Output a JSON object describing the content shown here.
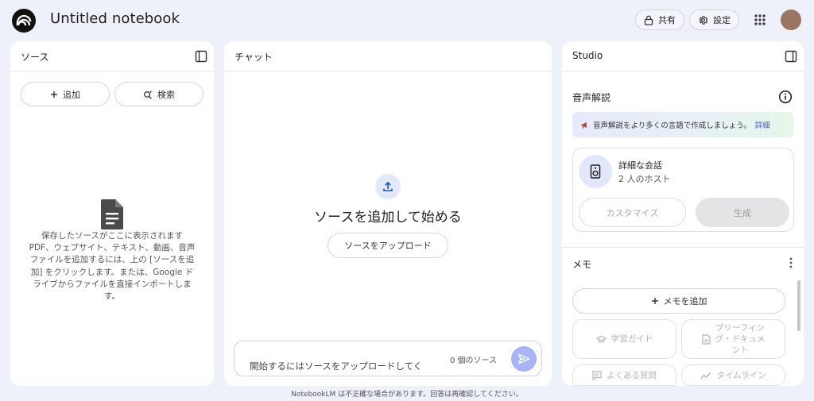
{
  "header": {
    "title": "Untitled notebook",
    "share_label": "共有",
    "settings_label": "設定"
  },
  "sources": {
    "title": "ソース",
    "add_label": "追加",
    "search_label": "検索",
    "empty_lines": [
      "保存したソースがここに表示されます",
      "PDF、ウェブサイト、テキスト、動画、音声",
      "ファイルを追加するには、上の [ソースを追",
      "加] をクリックします。または、Google ド",
      "ライブからファイルを直接インポートしま",
      "す。"
    ]
  },
  "chat": {
    "title": "チャット",
    "heading": "ソースを追加して始める",
    "upload_label": "ソースをアップロード",
    "input_placeholder": "開始するにはソースをアップロードしてく",
    "source_count": "0 個のソース"
  },
  "studio": {
    "title": "Studio",
    "audio_title": "音声解説",
    "banner_text": "音声解説をより多くの言語で作成しましょう。",
    "banner_link": "詳細",
    "card_title": "詳細な会話",
    "card_subtitle": "2 人のホスト",
    "customize_label": "カスタマイズ",
    "generate_label": "生成",
    "memo_title": "メモ",
    "add_memo_label": "メモを追加",
    "study_guide_label": "学習ガイド",
    "briefing_line1": "ブリーフィン",
    "briefing_line2": "グ・ドキュメ",
    "briefing_line3": "ント",
    "faq_label": "よくある質問",
    "timeline_label": "タイムライン"
  },
  "footer": {
    "disclaimer": "NotebookLM は不正確な場合があります。回答は再確認してください。"
  },
  "colors": {
    "background": "#eef0fa",
    "accent": "#a8b4f5",
    "avatar": "#9a7563",
    "link": "#3b5bdb"
  },
  "icons": [
    "notebooklm-logo-icon",
    "lock-icon",
    "gear-icon",
    "apps-grid-icon",
    "panel-toggle-icon",
    "plus-icon",
    "search-spark-icon",
    "document-icon",
    "upload-icon",
    "send-icon",
    "info-icon",
    "speaker-icon",
    "kebab-menu-icon",
    "study-guide-icon",
    "briefing-doc-icon",
    "faq-icon",
    "timeline-icon"
  ]
}
